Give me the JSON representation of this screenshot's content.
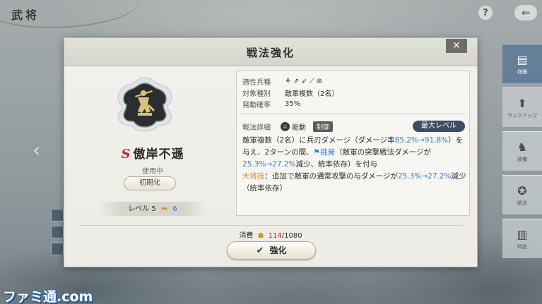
{
  "header": {
    "screen_title": "武将"
  },
  "icons": {
    "help": "?",
    "back": "⇐",
    "close": "✕",
    "arrow_right": "➡",
    "left_arrow": "‹",
    "check": "✔",
    "cost": "☗",
    "attack_type": "⚔"
  },
  "side_menu": {
    "items": [
      {
        "label": "詳細",
        "icon": "▤"
      },
      {
        "label": "ランクアップ",
        "icon": "⬆"
      },
      {
        "label": "装備",
        "icon": "♞"
      },
      {
        "label": "戦法",
        "icon": "✪"
      },
      {
        "label": "特技",
        "icon": "▥"
      }
    ]
  },
  "watermark": "ファミ通.com",
  "modal": {
    "title": "戦法強化",
    "skill": {
      "grade": "S",
      "name": "傲岸不遜",
      "status": "使用中",
      "reset_label": "初期化",
      "level_label": "レベル",
      "level_current": "5",
      "level_next": "6"
    },
    "info": {
      "unit_type_label": "適性兵種",
      "unit_icons": [
        "⚘",
        "⇗",
        "➶",
        "⟋",
        "⊛"
      ],
      "target_label": "対象種別",
      "target_value": "敵軍複数（2名）",
      "rate_label": "発動確率",
      "rate_value": "35%",
      "detail_label": "戦法詳細",
      "type_label": "能動",
      "tag_label": "制御",
      "max_level_label": "最大レベル",
      "description": {
        "p1": "敵軍複数（2名）に兵刃ダメージ（ダメージ率",
        "p1_blue": "85.2%→91.8%",
        "p2": "）を与え、2ターンの間、",
        "p2_blue": "挑発",
        "p3": "（敵軍の突撃戦法ダメージが",
        "p3_blue": "25.3%→27.2%",
        "p4": "減少、統率依存）を付与",
        "p5_orange": "大将技",
        "p5": "：追加で敵軍の通常攻撃の与ダメージが",
        "p5_blue": "25.3%→27.2%",
        "p6": "減少（統率依存）"
      }
    },
    "cost": {
      "label": "消費",
      "current": "114",
      "total": "/1080"
    },
    "enhance_label": "強化"
  }
}
